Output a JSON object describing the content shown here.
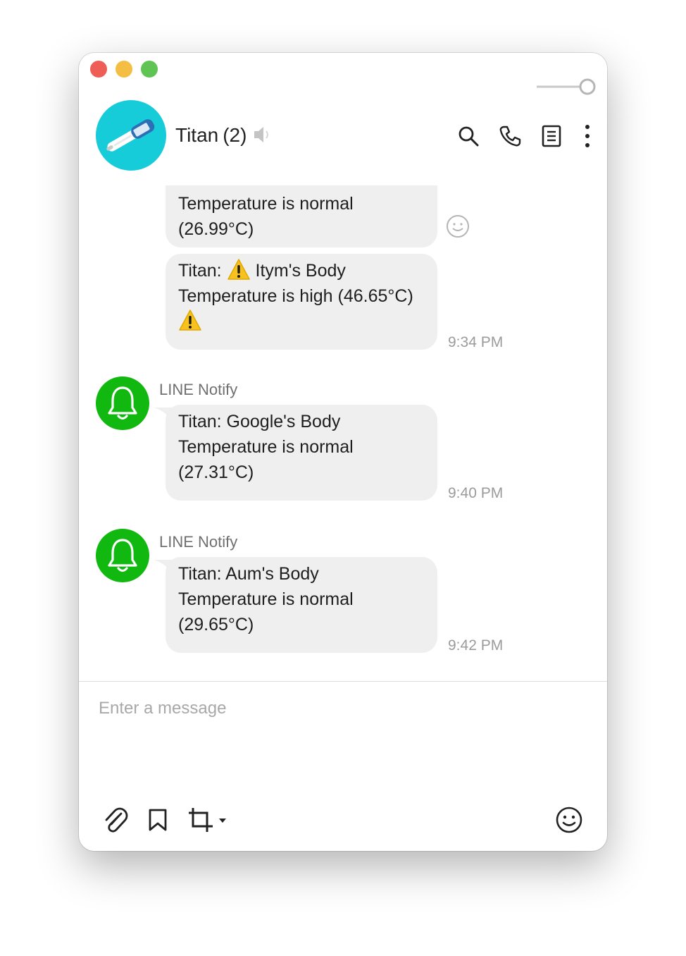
{
  "header": {
    "chat_name": "Titan",
    "member_count": "(2)"
  },
  "messages": [
    {
      "lines": [
        "Temperature is normal",
        "(26.99°C)"
      ],
      "partial_top": true
    },
    {
      "prefix": "Titan: ",
      "line1_suffix": " Itym's Body",
      "line2": "Temperature is high (46.65°C)",
      "time": "9:34 PM",
      "icon": "warning-icon"
    },
    {
      "sender": "LINE Notify",
      "lines": [
        "Titan: Google's Body",
        "Temperature is normal",
        "(27.31°C)"
      ],
      "time": "9:40 PM"
    },
    {
      "sender": "LINE Notify",
      "lines": [
        "Titan: Aum's Body",
        "Temperature is normal",
        "(29.65°C)"
      ],
      "time": "9:42 PM"
    }
  ],
  "composer": {
    "placeholder": "Enter a message"
  },
  "colors": {
    "avatar_bg": "#16ccd9",
    "notify_green": "#10b80f",
    "bubble_bg": "#efefef"
  },
  "icons": [
    "search-icon",
    "phone-icon",
    "notes-icon",
    "more-icon",
    "mute-icon",
    "attach-icon",
    "bookmark-icon",
    "crop-icon",
    "emoji-icon",
    "bell-icon"
  ]
}
